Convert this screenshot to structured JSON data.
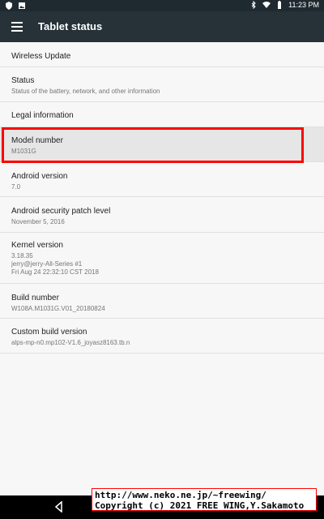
{
  "status_bar": {
    "time": "11:23 PM"
  },
  "app_bar": {
    "title": "Tablet status"
  },
  "items": [
    {
      "title": "Wireless Update",
      "subtitle": ""
    },
    {
      "title": "Status",
      "subtitle": "Status of the battery, network, and other information"
    },
    {
      "title": "Legal information",
      "subtitle": ""
    },
    {
      "title": "Model number",
      "subtitle": "M1031G"
    },
    {
      "title": "Android version",
      "subtitle": "7.0"
    },
    {
      "title": "Android security patch level",
      "subtitle": "November 5, 2016"
    },
    {
      "title": "Kernel version",
      "subtitle": "3.18.35\njerry@jerry-All-Series #1\nFri Aug 24 22:32:10 CST 2018"
    },
    {
      "title": "Build number",
      "subtitle": "W108A.M1031G.V01_20180824"
    },
    {
      "title": "Custom build version",
      "subtitle": "alps-mp-n0.mp102-V1.6_joyasz8163.tb.n"
    }
  ],
  "overlay": {
    "line1": "http://www.neko.ne.jp/~freewing/",
    "line2": "Copyright (c) 2021 FREE WING,Y.Sakamoto"
  }
}
